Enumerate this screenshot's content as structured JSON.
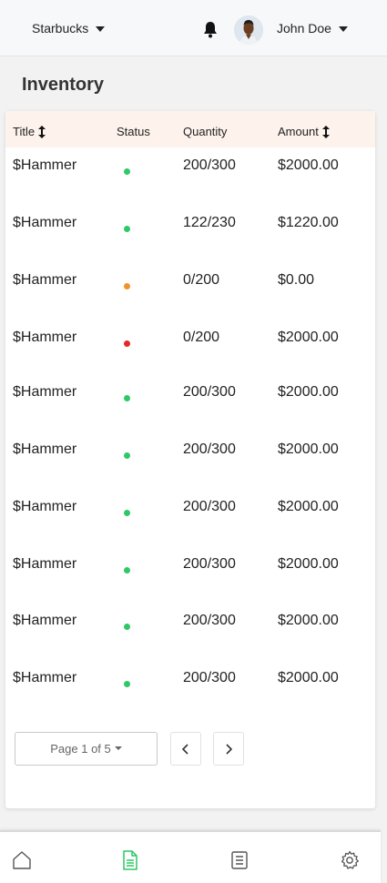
{
  "header": {
    "store_name": "Starbucks",
    "user_name": "John Doe"
  },
  "page": {
    "title": "Inventory"
  },
  "table": {
    "columns": [
      "Title",
      "Status",
      "Quantity",
      "Amount"
    ],
    "rows": [
      {
        "title": "$Hammer",
        "status": "in-stock",
        "status_color": "#2ec866",
        "quantity": "200/300",
        "amount": "$2000.00"
      },
      {
        "title": "$Hammer",
        "status": "in-stock",
        "status_color": "#2ec866",
        "quantity": "122/230",
        "amount": "$1220.00"
      },
      {
        "title": "$Hammer",
        "status": "low-stock",
        "status_color": "#f0932b",
        "quantity": "0/200",
        "amount": "$0.00"
      },
      {
        "title": "$Hammer",
        "status": "out-of-stock",
        "status_color": "#e8262a",
        "quantity": "0/200",
        "amount": "$2000.00"
      },
      {
        "title": "$Hammer",
        "status": "in-stock",
        "status_color": "#2ec866",
        "quantity": "200/300",
        "amount": "$2000.00"
      },
      {
        "title": "$Hammer",
        "status": "in-stock",
        "status_color": "#2ec866",
        "quantity": "200/300",
        "amount": "$2000.00"
      },
      {
        "title": "$Hammer",
        "status": "in-stock",
        "status_color": "#2ec866",
        "quantity": "200/300",
        "amount": "$2000.00"
      },
      {
        "title": "$Hammer",
        "status": "in-stock",
        "status_color": "#2ec866",
        "quantity": "200/300",
        "amount": "$2000.00"
      },
      {
        "title": "$Hammer",
        "status": "in-stock",
        "status_color": "#2ec866",
        "quantity": "200/300",
        "amount": "$2000.00"
      },
      {
        "title": "$Hammer",
        "status": "in-stock",
        "status_color": "#2ec866",
        "quantity": "200/300",
        "amount": "$2000.00"
      }
    ]
  },
  "pagination": {
    "label": "Page 1 of 5"
  },
  "bottom_nav": {
    "items": [
      {
        "icon": "home-icon",
        "active": false
      },
      {
        "icon": "document-icon",
        "active": true
      },
      {
        "icon": "list-icon",
        "active": false
      },
      {
        "icon": "gear-icon",
        "active": false
      }
    ],
    "active_color": "#2ec866",
    "inactive_color": "#555555"
  }
}
